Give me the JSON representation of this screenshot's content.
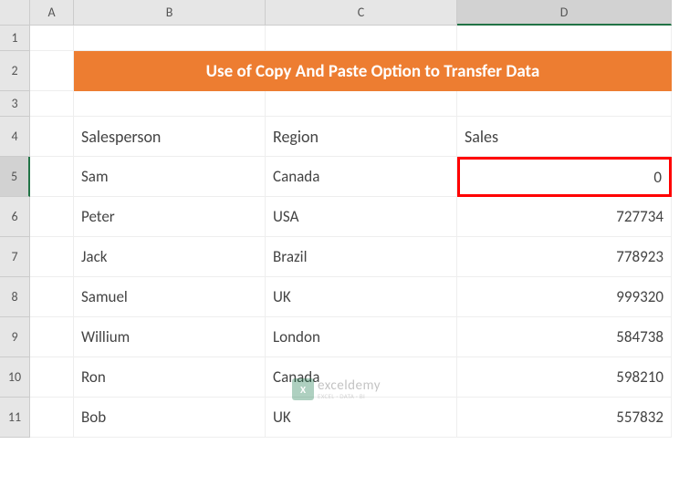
{
  "columns": [
    "A",
    "B",
    "C",
    "D"
  ],
  "rows": [
    "1",
    "2",
    "3",
    "4",
    "5",
    "6",
    "7",
    "8",
    "9",
    "10",
    "11"
  ],
  "title": "Use of Copy And Paste Option to Transfer Data",
  "headers": {
    "salesperson": "Salesperson",
    "region": "Region",
    "sales": "Sales"
  },
  "data": [
    {
      "salesperson": "Sam",
      "region": "Canada",
      "sales": "0"
    },
    {
      "salesperson": "Peter",
      "region": "USA",
      "sales": "727734"
    },
    {
      "salesperson": "Jack",
      "region": "Brazil",
      "sales": "778923"
    },
    {
      "salesperson": "Samuel",
      "region": "UK",
      "sales": "999320"
    },
    {
      "salesperson": "Willium",
      "region": "London",
      "sales": "584738"
    },
    {
      "salesperson": "Ron",
      "region": "Canada",
      "sales": "598210"
    },
    {
      "salesperson": "Bob",
      "region": "UK",
      "sales": "557832"
    }
  ],
  "selected_cell": "D5",
  "watermark": {
    "main": "exceldemy",
    "sub": "EXCEL · DATA · BI"
  }
}
